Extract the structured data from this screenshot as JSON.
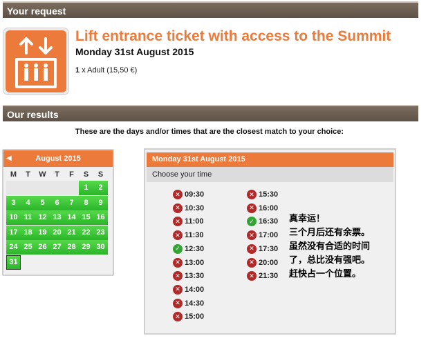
{
  "sections": {
    "request": "Your request",
    "results": "Our results"
  },
  "request": {
    "title": "Lift entrance ticket with access to the Summit",
    "date": "Monday 31st August 2015",
    "quantity": "1",
    "ticket": "x Adult (15,50 €)"
  },
  "intro": "These are the days and/or times that are the closest match to your choice:",
  "calendar": {
    "month": "August 2015",
    "prev_icon": "chevron-left-icon",
    "weekdays": [
      "M",
      "T",
      "W",
      "T",
      "F",
      "S",
      "S"
    ],
    "weeks": [
      [
        "",
        "",
        "",
        "",
        "",
        "1",
        "2"
      ],
      [
        "3",
        "4",
        "5",
        "6",
        "7",
        "8",
        "9"
      ],
      [
        "10",
        "11",
        "12",
        "13",
        "14",
        "15",
        "16"
      ],
      [
        "17",
        "18",
        "19",
        "20",
        "21",
        "22",
        "23"
      ],
      [
        "24",
        "25",
        "26",
        "27",
        "28",
        "29",
        "30"
      ],
      [
        "31",
        "",
        "",
        "",
        "",
        "",
        ""
      ]
    ],
    "selected": "31",
    "colors": {
      "available": "#2bb52a",
      "header": "#ec7a3a"
    }
  },
  "time_panel": {
    "date": "Monday 31st August 2015",
    "choose_label": "Choose your time",
    "column1": [
      {
        "time": "09:30",
        "available": false
      },
      {
        "time": "10:30",
        "available": false
      },
      {
        "time": "11:00",
        "available": false
      },
      {
        "time": "11:30",
        "available": false
      },
      {
        "time": "12:30",
        "available": true
      },
      {
        "time": "13:00",
        "available": false
      },
      {
        "time": "13:30",
        "available": false
      },
      {
        "time": "14:00",
        "available": false
      },
      {
        "time": "14:30",
        "available": false
      },
      {
        "time": "15:00",
        "available": false
      }
    ],
    "column2": [
      {
        "time": "15:30",
        "available": false
      },
      {
        "time": "16:00",
        "available": false
      },
      {
        "time": "16:30",
        "available": true
      },
      {
        "time": "17:00",
        "available": false
      },
      {
        "time": "17:30",
        "available": false
      },
      {
        "time": "20:00",
        "available": false
      },
      {
        "time": "21:30",
        "available": false
      }
    ]
  },
  "note_lines": [
    "真幸运！",
    "三个月后还有余票。",
    "虽然没有合适的时间",
    "了，总比没有强吧。",
    "赶快占一个位置。"
  ],
  "colors": {
    "brand_orange": "#ec7a3a",
    "bar_brown": "#6b5f53",
    "unavailable": "#b12a2a",
    "available": "#34a534"
  }
}
